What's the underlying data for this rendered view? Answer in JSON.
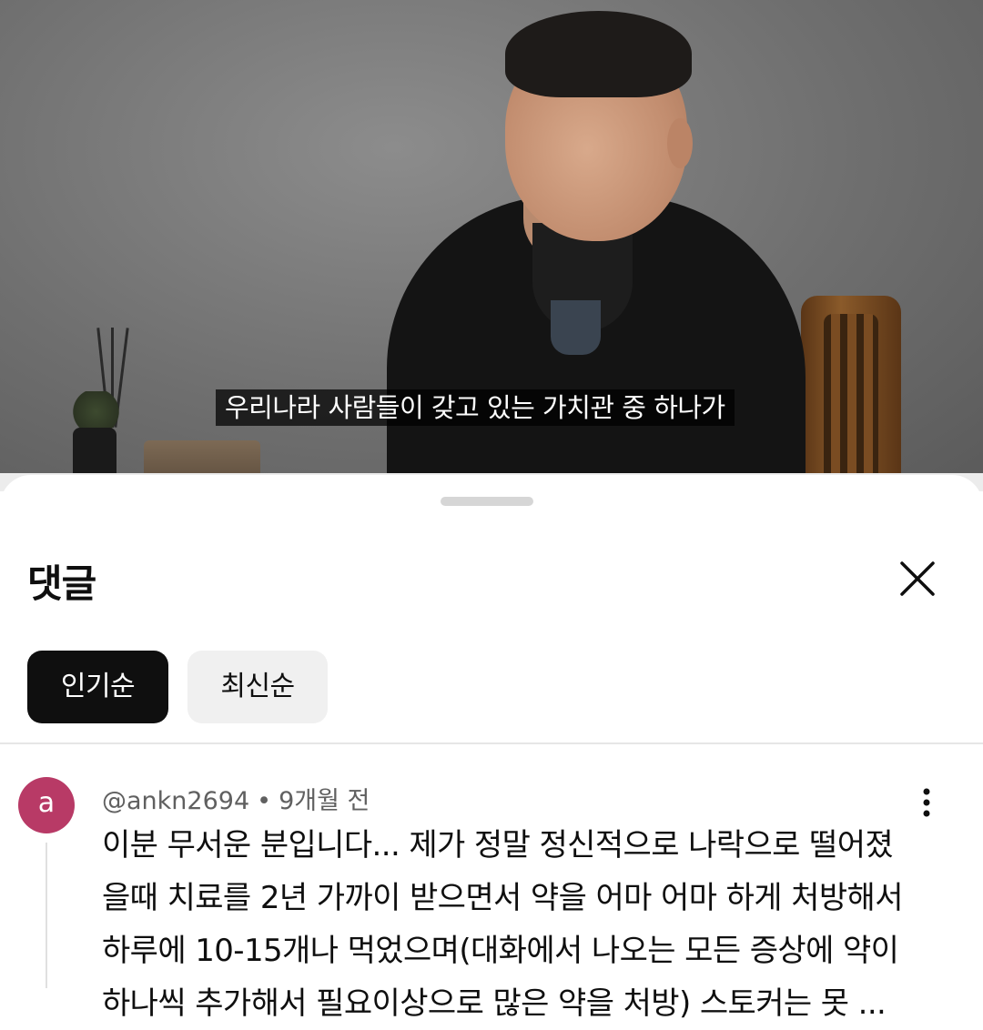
{
  "video": {
    "subtitle": "우리나라 사람들이 갖고 있는 가치관 중 하나가"
  },
  "comments_panel": {
    "title": "댓글",
    "sort_tabs": [
      {
        "label": "인기순",
        "selected": true
      },
      {
        "label": "최신순",
        "selected": false
      }
    ],
    "comment": {
      "avatar_letter": "a",
      "author": "@ankn2694",
      "time": "9개월 전",
      "lines": [
        "이분 무서운 분입니다... 제가 정말 정신적으로 나락으로 떨어졌",
        "을때 치료를 2년 가까이 받으면서 약을 어마 어마 하게 처방해서",
        "하루에 10-15개나 먹었으며(대화에서 나오는 모든 증상에 약이",
        "하나씩 추가해서 필요이상으로 많은 약을 처방) 스토커는 못 ..."
      ]
    }
  },
  "colors": {
    "avatar": "#b83a66",
    "chip_active_bg": "#0f0f0f",
    "chip_inactive_bg": "#f0f0f0"
  }
}
